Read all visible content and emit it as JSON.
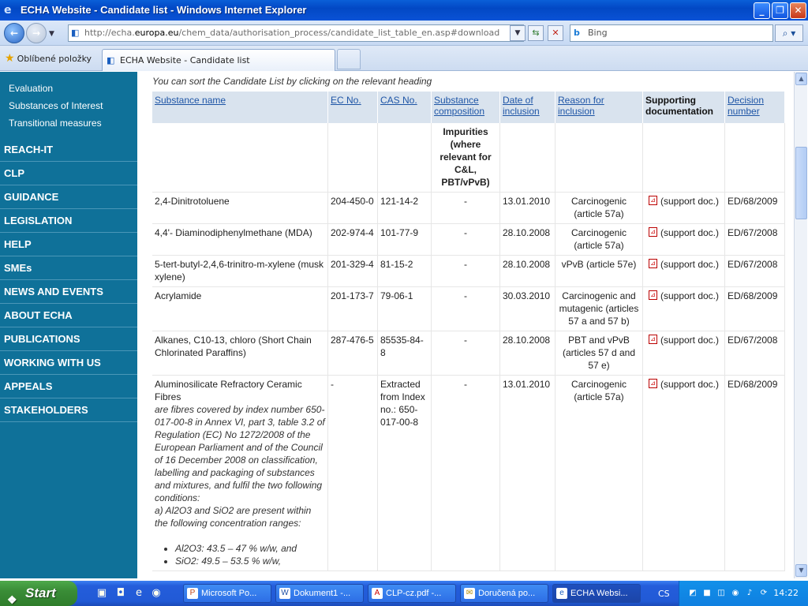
{
  "window": {
    "title": "ECHA Website - Candidate list - Windows Internet Explorer",
    "min_icon": "minimize-icon",
    "max_icon": "maximize-icon",
    "close_icon": "close-icon"
  },
  "address_bar": {
    "url_prefix": "http://echa.",
    "url_domain": "europa.eu",
    "url_path": "/chem_data/authorisation_process/candidate_list_table_en.asp#download",
    "search_placeholder": "Bing"
  },
  "favorites": {
    "label": "Oblíbené položky"
  },
  "tab": {
    "label": "ECHA Website - Candidate list"
  },
  "sidebar": {
    "sub_items": [
      "Evaluation",
      "Substances of Interest",
      "Transitional measures"
    ],
    "menu_items": [
      "REACH-IT",
      "CLP",
      "GUIDANCE",
      "LEGISLATION",
      "HELP",
      "SMEs",
      "NEWS AND EVENTS",
      "ABOUT ECHA",
      "PUBLICATIONS",
      "WORKING WITH US",
      "APPEALS",
      "STAKEHOLDERS"
    ]
  },
  "main": {
    "hint": "You can sort the Candidate List by clicking on the relevant heading",
    "headers": {
      "name": "Substance name",
      "ec": "EC No.",
      "cas": "CAS No.",
      "composition": "Substance composition",
      "date": "Date of inclusion",
      "reason": "Reason for inclusion",
      "supporting": "Supporting documentation",
      "decision": "Decision number"
    },
    "impurities": "Impurities (where relevant for C&L, PBT/vPvB)",
    "rows": [
      {
        "name": "2,4-Dinitrotoluene",
        "ec": "204-450-0",
        "cas": "121-14-2",
        "comp": "-",
        "date": "13.01.2010",
        "reason": "Carcinogenic (article 57a)",
        "doc": "(support doc.)",
        "decision": "ED/68/2009"
      },
      {
        "name": "4,4'- Diaminodiphenylmethane (MDA)",
        "ec": "202-974-4",
        "cas": "101-77-9",
        "comp": "-",
        "date": "28.10.2008",
        "reason": "Carcinogenic (article 57a)",
        "doc": "(support doc.)",
        "decision": "ED/67/2008"
      },
      {
        "name": "5-tert-butyl-2,4,6-trinitro-m-xylene (musk xylene)",
        "ec": "201-329-4",
        "cas": "81-15-2",
        "comp": "-",
        "date": "28.10.2008",
        "reason": "vPvB (article 57e)",
        "doc": "(support doc.)",
        "decision": "ED/67/2008"
      },
      {
        "name": "Acrylamide",
        "ec": "201-173-7",
        "cas": "79-06-1",
        "comp": "-",
        "date": "30.03.2010",
        "reason": "Carcinogenic and mutagenic (articles 57 a and 57 b)",
        "doc": "(support doc.)",
        "decision": "ED/68/2009"
      },
      {
        "name": "Alkanes, C10-13, chloro (Short Chain Chlorinated Paraffins)",
        "ec": "287-476-5",
        "cas": "85535-84-8",
        "comp": "-",
        "date": "28.10.2008",
        "reason": "PBT and vPvB (articles 57 d and 57 e)",
        "doc": "(support doc.)",
        "decision": "ED/67/2008"
      },
      {
        "name": "Aluminosilicate Refractory Ceramic Fibres",
        "ec": "-",
        "cas": "Extracted from Index no.: 650-017-00-8",
        "comp": "-",
        "date": "13.01.2010",
        "reason": "Carcinogenic (article 57a)",
        "doc": "(support doc.)",
        "decision": "ED/68/2009"
      }
    ],
    "desc_main": "are fibres covered by index number 650-017-00-8 in Annex VI, part 3, table 3.2 of Regulation (EC) No 1272/2008 of the European Parliament and of the Council of 16 December 2008 on classification, labelling and packaging of substances and mixtures, and fulfil the two following conditions:",
    "desc_a": "a) Al2O3 and SiO2 are present within the following concentration ranges:",
    "desc_li1": "Al2O3: 43.5 – 47 % w/w, and",
    "desc_li2": "SiO2: 49.5 – 53.5 % w/w,"
  },
  "taskbar": {
    "start": "Start",
    "buttons": [
      "Microsoft Po...",
      "Dokument1 -...",
      "CLP-cz.pdf -...",
      "Doručená po...",
      "ECHA Websi..."
    ],
    "lang": "CS",
    "clock": "14:22"
  }
}
